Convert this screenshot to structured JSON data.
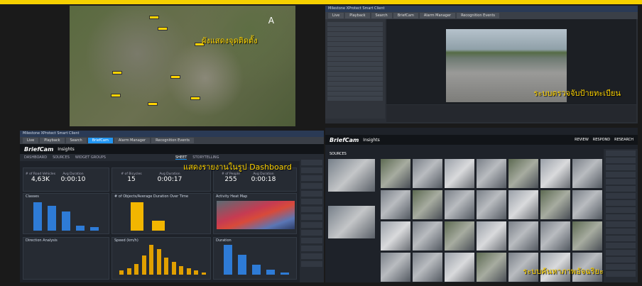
{
  "map": {
    "caption": "ผังแสดงจุดติดตั้ง",
    "compass": "A"
  },
  "lpr": {
    "title": "Milestone XProtect Smart Client",
    "tabs": [
      "Live",
      "Playback",
      "Search",
      "BriefCam",
      "Alarm Manager",
      "Recognition Events"
    ],
    "caption": "ระบบตรวจจับป้ายทะเบียน"
  },
  "dashboard": {
    "title": "Milestone XProtect Smart Client",
    "tabs": [
      "Live",
      "Playback",
      "Search",
      "BriefCam",
      "Alarm Manager",
      "Recognition Events"
    ],
    "logo": "BriefCam",
    "product": "Insights",
    "subnav": [
      "DASHBOARD",
      "SOURCES",
      "WIDGET GROUPS",
      "SHEET",
      "STORYTELLING"
    ],
    "caption": "แสดงรายงานในรูป Dashboard",
    "stats": [
      {
        "label": "# of Road Vehicles",
        "value": "4,63K"
      },
      {
        "label": "Avg Duration",
        "value": "0:00:10"
      },
      {
        "label": "# of Bicycles",
        "value": "15"
      },
      {
        "label": "Avg Duration",
        "value": "0:00:17"
      },
      {
        "label": "# of People",
        "value": "255"
      },
      {
        "label": "Avg Duration",
        "value": "0:00:18"
      }
    ],
    "cards": [
      "Classes",
      "# of Objects/Average Duration Over Time",
      "Activity Heat Map",
      "Direction Analysis",
      "Speed (km/h)",
      "Duration"
    ]
  },
  "search": {
    "logo": "BriefCam",
    "product": "Insights",
    "tabs": [
      "REVIEW",
      "RESPOND",
      "RESEARCH"
    ],
    "sources_label": "SOURCES",
    "caption": "ระบบค้นหาภาพอัจฉริยะ"
  },
  "chart_data": [
    {
      "type": "bar",
      "title": "Classes",
      "values": [
        1.6,
        1.4,
        1.1,
        0.3,
        0.2
      ]
    },
    {
      "type": "bar",
      "title": "# of Objects/Average Duration Over Time",
      "values": [
        1.0,
        0.35
      ]
    },
    {
      "type": "bar",
      "title": "Speed (km/h)",
      "values": [
        2,
        3,
        5,
        9,
        14,
        12,
        8,
        6,
        4,
        3,
        2,
        1
      ]
    },
    {
      "type": "bar",
      "title": "Duration",
      "values": [
        12,
        8,
        4,
        2,
        1
      ]
    }
  ]
}
